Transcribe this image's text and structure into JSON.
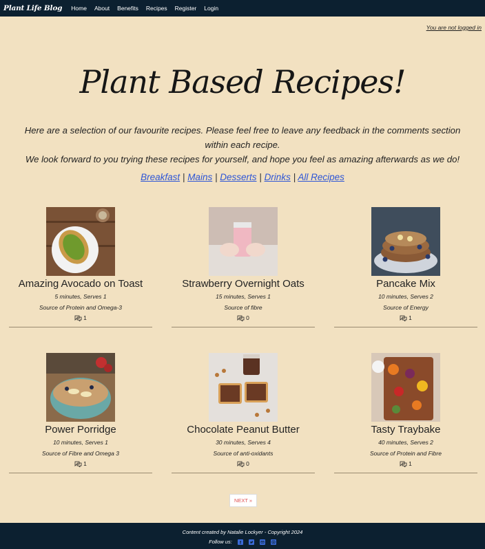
{
  "nav": {
    "brand": "Plant Life Blog",
    "links": [
      "Home",
      "About",
      "Benefits",
      "Recipes",
      "Register",
      "Login"
    ]
  },
  "login_status": "You are not logged in",
  "hero": {
    "title": "Plant Based Recipes!"
  },
  "intro": {
    "line1": "Here are a selection of our favourite recipes. Please feel free to leave any feedback in the comments section within each recipe.",
    "line2": "We look forward to you trying these recipes for yourself, and hope you feel as amazing afterwards as we do!"
  },
  "categories": [
    "Breakfast",
    "Mains",
    "Desserts",
    "Drinks",
    "All Recipes"
  ],
  "category_separator": "|",
  "recipes": [
    {
      "title": "Amazing Avocado on Toast",
      "meta": "5 minutes, Serves 1",
      "source": "Source of Protein and Omega-3",
      "comments": "1"
    },
    {
      "title": "Strawberry Overnight Oats",
      "meta": "15 minutes, Serves 1",
      "source": "Source of fibre",
      "comments": "0"
    },
    {
      "title": "Pancake Mix",
      "meta": "10 minutes, Serves 2",
      "source": "Source of Energy",
      "comments": "1"
    },
    {
      "title": "Power Porridge",
      "meta": "10 minutes, Serves 1",
      "source": "Source of Fibre and Omega 3",
      "comments": "1"
    },
    {
      "title": "Chocolate Peanut Butter",
      "meta": "30 minutes, Serves 4",
      "source": "Source of anti-oxidants",
      "comments": "0"
    },
    {
      "title": "Tasty Traybake",
      "meta": "40 minutes, Serves 2",
      "source": "Source of Protein and Fibre",
      "comments": "1"
    }
  ],
  "pagination": {
    "next_label": "NEXT »"
  },
  "footer": {
    "copyright": "Content created by Natalie Lockyer - Copyright 2024",
    "follow_label": "Follow us:",
    "social_icons": [
      "facebook-icon",
      "twitter-icon",
      "email-icon",
      "instagram-icon"
    ]
  },
  "colors": {
    "background": "#f2e1c1",
    "navbar": "#0c2030",
    "link": "#2d55d6",
    "next": "#e05050"
  }
}
